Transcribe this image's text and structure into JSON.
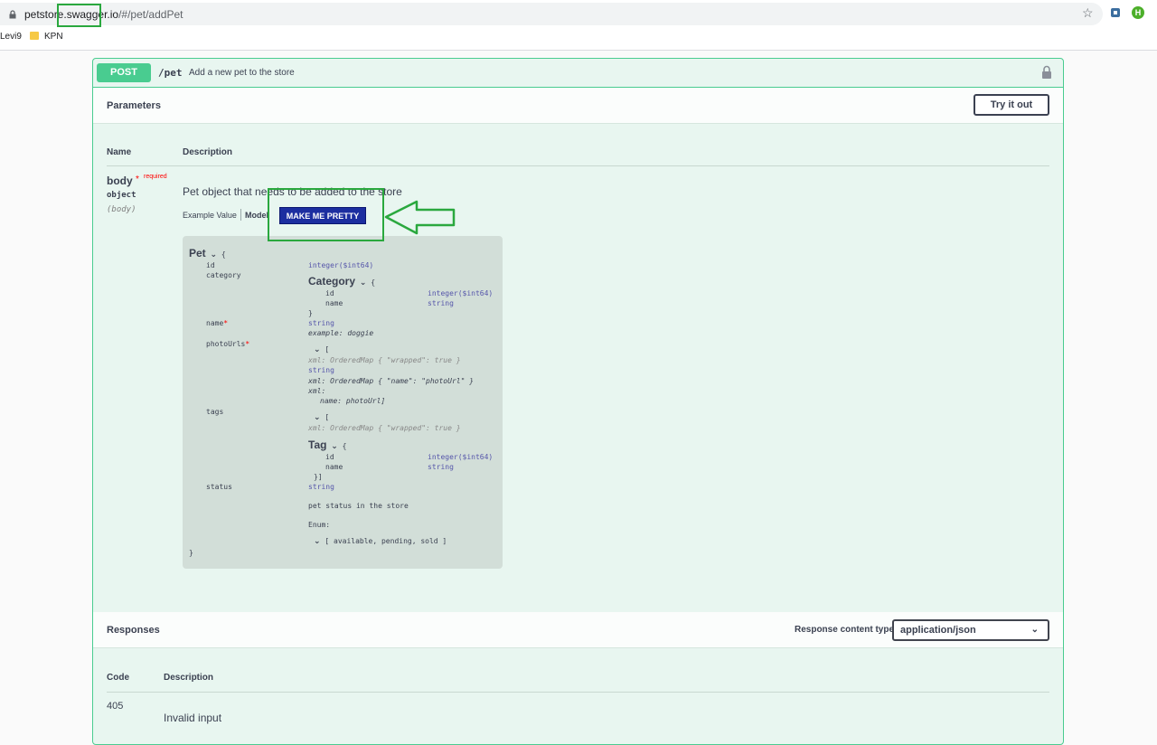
{
  "browser": {
    "url_host_prefix": "petstore.",
    "url_host_highlight": "swagger.",
    "url_host_suffix": "io",
    "url_path": "/#/pet/addPet",
    "bookmarks": [
      "Levi9",
      "KPN"
    ],
    "star_icon": "star-icon",
    "profile_initial": "H"
  },
  "operation": {
    "method": "POST",
    "path": "/pet",
    "summary": "Add a new pet to the store",
    "accent_color": "#49cc90"
  },
  "parameters": {
    "title": "Parameters",
    "try_label": "Try it out",
    "col_name": "Name",
    "col_description": "Description",
    "param": {
      "name": "body",
      "required_star": "*",
      "required_label": "required",
      "type": "object",
      "in": "(body)",
      "description": "Pet object that needs to be added to the store",
      "tab_example": "Example Value",
      "tab_model": "Model",
      "pretty_button": "MAKE ME PRETTY"
    }
  },
  "model": {
    "pet_title": "Pet",
    "open_brace": "{",
    "close_brace": "}",
    "id": "id",
    "id_type": "integer($int64)",
    "category": "category",
    "category_title": "Category",
    "cat_id": "id",
    "cat_id_type": "integer($int64)",
    "cat_name": "name",
    "cat_name_type": "string",
    "cat_close": "}",
    "name": "name",
    "name_star": "*",
    "name_type": "string",
    "name_example": "example: doggie",
    "photourls": "photoUrls",
    "photourls_star": "*",
    "photo_open": "[",
    "photo_xml_wrapped": "xml: OrderedMap { \"wrapped\": true }",
    "photo_item_type": "string",
    "photo_xml_name": "xml: OrderedMap { \"name\": \"photoUrl\" }",
    "photo_xml": "xml:",
    "photo_xml_name2": "name: photoUrl]",
    "tags": "tags",
    "tags_open": "[",
    "tags_xml_wrapped": "xml: OrderedMap { \"wrapped\": true }",
    "tag_title": "Tag",
    "tag_id": "id",
    "tag_id_type": "integer($int64)",
    "tag_name": "name",
    "tag_name_type": "string",
    "tag_close": "}]",
    "status": "status",
    "status_type": "string",
    "status_desc": "pet status in the store",
    "enum_label": "Enum:",
    "enum_values": "[ available, pending, sold ]"
  },
  "responses": {
    "title": "Responses",
    "content_type_label": "Response content type",
    "content_type_value": "application/json",
    "col_code": "Code",
    "col_description": "Description",
    "rows": [
      {
        "code": "405",
        "description": "Invalid input"
      }
    ]
  },
  "annotation_color": "#2aa83e"
}
